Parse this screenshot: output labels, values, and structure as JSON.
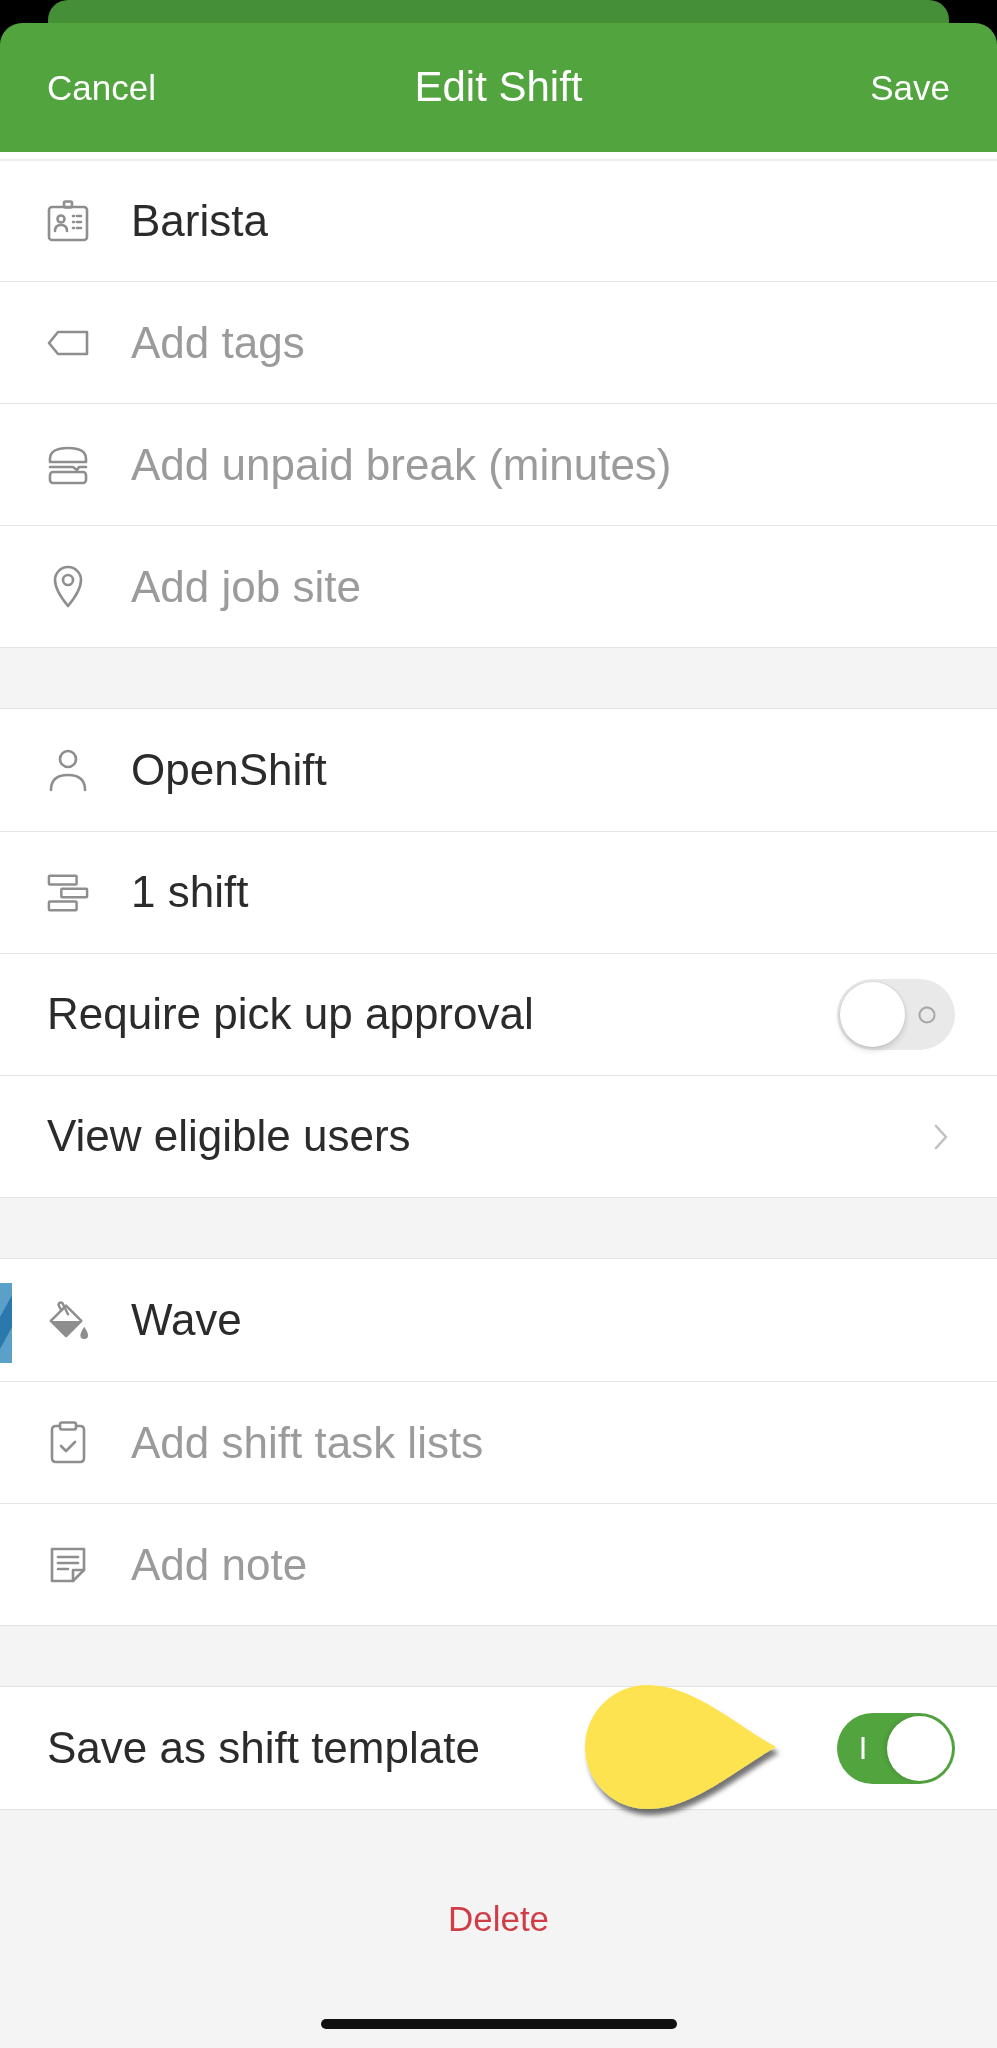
{
  "header": {
    "cancel": "Cancel",
    "title": "Edit Shift",
    "save": "Save"
  },
  "sections": [
    {
      "rows": [
        {
          "kind": "position",
          "value": "Barista"
        },
        {
          "kind": "tags",
          "placeholder": "Add tags"
        },
        {
          "kind": "break",
          "placeholder": "Add unpaid break (minutes)"
        },
        {
          "kind": "site",
          "placeholder": "Add job site"
        }
      ]
    },
    {
      "rows": [
        {
          "kind": "assignee",
          "value": "OpenShift"
        },
        {
          "kind": "count",
          "value": "1 shift"
        },
        {
          "kind": "toggle",
          "label": "Require pick up approval",
          "on": false
        },
        {
          "kind": "link",
          "label": "View eligible users"
        }
      ]
    },
    {
      "rows": [
        {
          "kind": "color",
          "value": "Wave",
          "color": "#5aa0c8"
        },
        {
          "kind": "tasks",
          "placeholder": "Add shift task lists"
        },
        {
          "kind": "note",
          "placeholder": "Add note"
        }
      ]
    },
    {
      "rows": [
        {
          "kind": "toggle",
          "label": "Save as shift template",
          "on": true
        }
      ]
    }
  ],
  "delete": "Delete"
}
